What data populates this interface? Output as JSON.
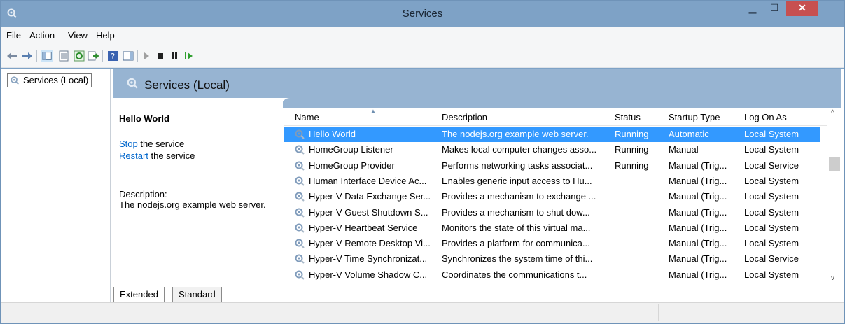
{
  "window": {
    "title": "Services"
  },
  "menu": {
    "items": [
      "File",
      "Action",
      "View",
      "Help"
    ]
  },
  "tree": {
    "item": "Services (Local)"
  },
  "header": {
    "title": "Services (Local)"
  },
  "details": {
    "service_name": "Hello World",
    "stop_link": "Stop",
    "stop_suffix": " the service",
    "restart_link": "Restart",
    "restart_suffix": " the service",
    "desc_label": "Description:",
    "desc_text": "The nodejs.org example web server."
  },
  "table": {
    "columns": [
      "Name",
      "Description",
      "Status",
      "Startup Type",
      "Log On As"
    ],
    "rows": [
      {
        "name": "Hello World",
        "description": "The nodejs.org example web server.",
        "status": "Running",
        "startup": "Automatic",
        "logon": "Local System",
        "selected": true
      },
      {
        "name": "HomeGroup Listener",
        "description": "Makes local computer changes asso...",
        "status": "Running",
        "startup": "Manual",
        "logon": "Local System"
      },
      {
        "name": "HomeGroup Provider",
        "description": "Performs networking tasks associat...",
        "status": "Running",
        "startup": "Manual (Trig...",
        "logon": "Local Service"
      },
      {
        "name": "Human Interface Device Ac...",
        "description": "Enables generic input access to Hu...",
        "status": "",
        "startup": "Manual (Trig...",
        "logon": "Local System"
      },
      {
        "name": "Hyper-V Data Exchange Ser...",
        "description": "Provides a mechanism to exchange ...",
        "status": "",
        "startup": "Manual (Trig...",
        "logon": "Local System"
      },
      {
        "name": "Hyper-V Guest Shutdown S...",
        "description": "Provides a mechanism to shut dow...",
        "status": "",
        "startup": "Manual (Trig...",
        "logon": "Local System"
      },
      {
        "name": "Hyper-V Heartbeat Service",
        "description": "Monitors the state of this virtual ma...",
        "status": "",
        "startup": "Manual (Trig...",
        "logon": "Local System"
      },
      {
        "name": "Hyper-V Remote Desktop Vi...",
        "description": "Provides a platform for communica...",
        "status": "",
        "startup": "Manual (Trig...",
        "logon": "Local System"
      },
      {
        "name": "Hyper-V Time Synchronizat...",
        "description": "Synchronizes the system time of thi...",
        "status": "",
        "startup": "Manual (Trig...",
        "logon": "Local Service"
      },
      {
        "name": "Hyper-V Volume Shadow C...",
        "description": "Coordinates the communications t...",
        "status": "",
        "startup": "Manual (Trig...",
        "logon": "Local System"
      }
    ]
  },
  "tabs": {
    "extended": "Extended",
    "standard": "Standard"
  },
  "colors": {
    "selection": "#3399ff",
    "header_band": "#97b4d2",
    "titlebar": "#7ea2c6",
    "close": "#c75050"
  }
}
